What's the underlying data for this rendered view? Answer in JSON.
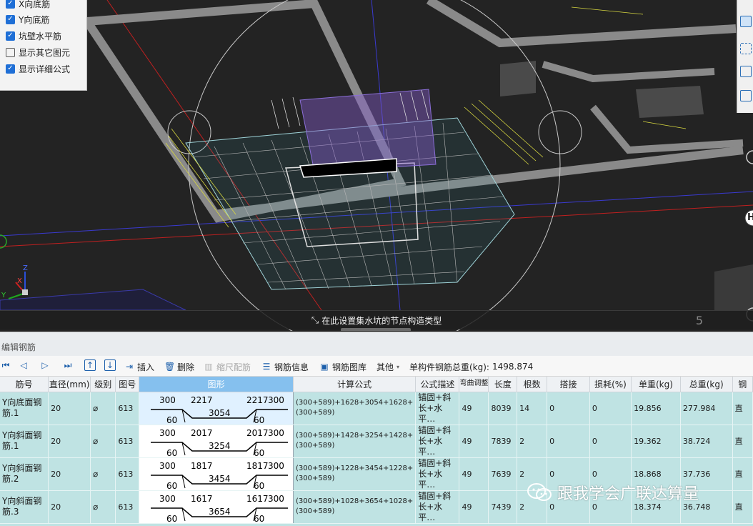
{
  "view_options": {
    "items": [
      {
        "label": "X向底筋",
        "checked": true
      },
      {
        "label": "Y向底筋",
        "checked": true
      },
      {
        "label": "坑壁水平筋",
        "checked": true
      },
      {
        "label": "显示其它图元",
        "checked": false
      },
      {
        "label": "显示详细公式",
        "checked": true
      }
    ]
  },
  "viewport": {
    "hint": "在此设置集水坑的节点构造类型",
    "page_number": "5",
    "axis_labels": {
      "x": "X",
      "y": "Y",
      "z": "Z"
    },
    "grid_marker_right": "H"
  },
  "panel": {
    "title": "编辑钢筋"
  },
  "toolbar": {
    "insert": "插入",
    "delete": "删除",
    "scale_rebar": "缩尺配筋",
    "rebar_info": "钢筋信息",
    "rebar_library": "钢筋图库",
    "other": "其他",
    "total_weight_label": "单构件钢筋总重(kg):",
    "total_weight_value": "1498.874"
  },
  "table": {
    "headers": [
      "筋号",
      "直径(mm)",
      "级别",
      "图号",
      "图形",
      "计算公式",
      "公式描述",
      "弯曲调整",
      "长度",
      "根数",
      "搭接",
      "损耗(%)",
      "单重(kg)",
      "总重(kg)",
      "钢"
    ],
    "rows": [
      {
        "name": "Y向底面钢筋.1",
        "diameter": "20",
        "grade": "⌀",
        "fig_no": "613",
        "shape": {
          "top_left": "300",
          "top_mid_left": "2217",
          "top_mid_right": "2217",
          "top_right": "300",
          "bottom_left": "60",
          "bottom_mid": "3054",
          "bottom_right": "60"
        },
        "formula": "(300+589)+1628+3054+1628+(300+589)",
        "desc": "锚固+斜长+水平…",
        "bend": "49",
        "length": "8039",
        "count": "14",
        "lap": "0",
        "loss": "0",
        "unit_weight": "19.856",
        "total_weight": "277.984",
        "extra": "直"
      },
      {
        "name": "Y向斜面钢筋.1",
        "diameter": "20",
        "grade": "⌀",
        "fig_no": "613",
        "shape": {
          "top_left": "300",
          "top_mid_left": "2017",
          "top_mid_right": "2017",
          "top_right": "300",
          "bottom_left": "60",
          "bottom_mid": "3254",
          "bottom_right": "60"
        },
        "formula": "(300+589)+1428+3254+1428+(300+589)",
        "desc": "锚固+斜长+水平…",
        "bend": "49",
        "length": "7839",
        "count": "2",
        "lap": "0",
        "loss": "0",
        "unit_weight": "19.362",
        "total_weight": "38.724",
        "extra": "直"
      },
      {
        "name": "Y向斜面钢筋.2",
        "diameter": "20",
        "grade": "⌀",
        "fig_no": "613",
        "shape": {
          "top_left": "300",
          "top_mid_left": "1817",
          "top_mid_right": "1817",
          "top_right": "300",
          "bottom_left": "60",
          "bottom_mid": "3454",
          "bottom_right": "60"
        },
        "formula": "(300+589)+1228+3454+1228+(300+589)",
        "desc": "锚固+斜长+水平…",
        "bend": "49",
        "length": "7639",
        "count": "2",
        "lap": "0",
        "loss": "0",
        "unit_weight": "18.868",
        "total_weight": "37.736",
        "extra": "直"
      },
      {
        "name": "Y向斜面钢筋.3",
        "diameter": "20",
        "grade": "⌀",
        "fig_no": "613",
        "shape": {
          "top_left": "300",
          "top_mid_left": "1617",
          "top_mid_right": "1617",
          "top_right": "300",
          "bottom_left": "60",
          "bottom_mid": "3654",
          "bottom_right": "60"
        },
        "formula": "(300+589)+1028+3654+1028+(300+589)",
        "desc": "锚固+斜长+水平…",
        "bend": "49",
        "length": "7439",
        "count": "2",
        "lap": "0",
        "loss": "0",
        "unit_weight": "18.374",
        "total_weight": "36.748",
        "extra": "直"
      }
    ]
  },
  "watermark": {
    "text": "跟我学会广联达算量"
  }
}
